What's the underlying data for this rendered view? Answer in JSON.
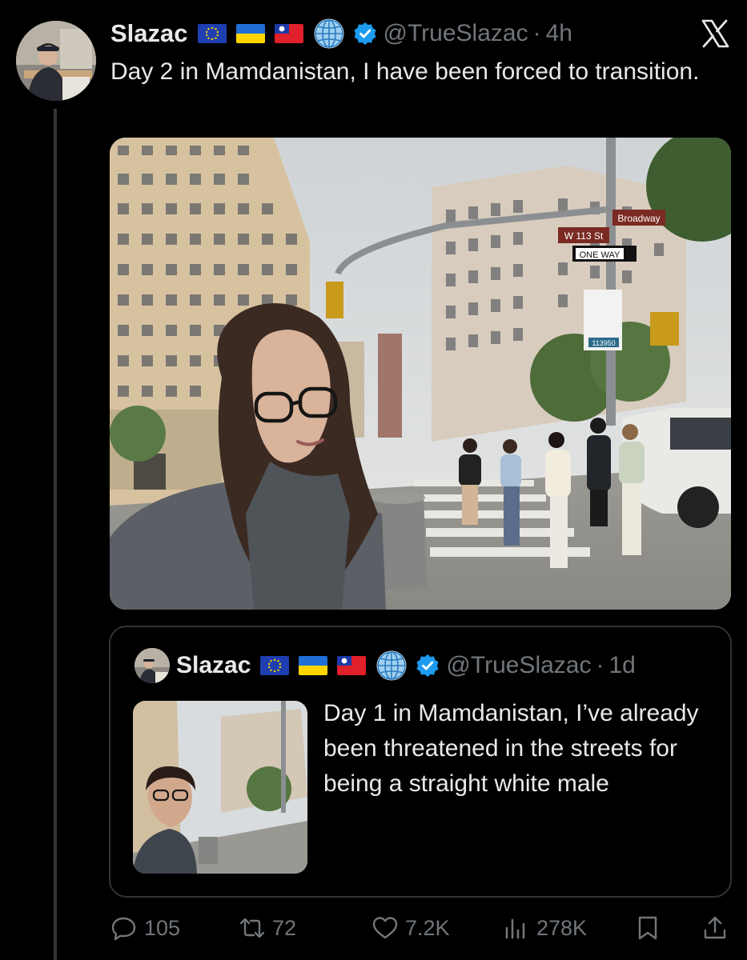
{
  "tweet": {
    "display_name": "Slazac",
    "handle": "@TrueSlazac",
    "separator": "·",
    "time": "4h",
    "text": "Day 2 in Mamdanistan, I have been forced to transition.",
    "badges": [
      "eu-flag",
      "ukraine-flag",
      "taiwan-flag",
      "globe-icon",
      "verified-badge"
    ],
    "media": {
      "signs": {
        "broadway": "Broadway",
        "street": "W 113 St",
        "one_way": "ONE WAY",
        "sign_number": "113950"
      }
    }
  },
  "quoted_tweet": {
    "display_name": "Slazac",
    "handle": "@TrueSlazac",
    "separator": "·",
    "time": "1d",
    "text": "Day 1 in Mamdanistan, I’ve already been threatened in the streets for being a straight white male"
  },
  "actions": {
    "replies": "105",
    "reposts": "72",
    "likes": "7.2K",
    "views": "278K"
  },
  "colors": {
    "background": "#000000",
    "text": "#e7e9ea",
    "muted": "#71767b",
    "verified": "#1d9bf0",
    "border": "#2f3336"
  }
}
